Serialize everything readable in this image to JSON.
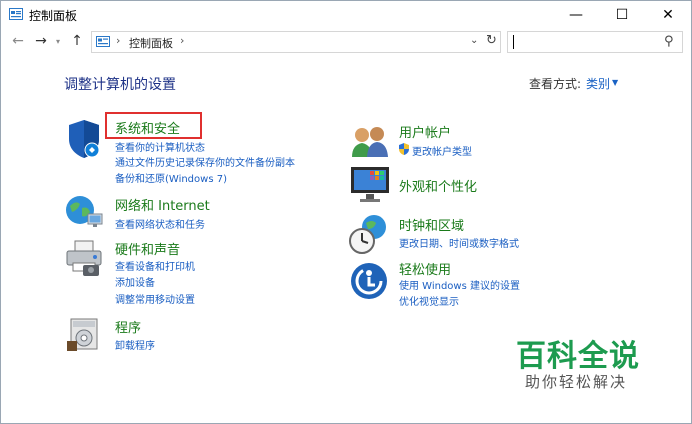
{
  "window": {
    "title": "控制面板",
    "controls": {
      "minimize": "—",
      "maximize": "☐",
      "close": "✕"
    }
  },
  "nav": {
    "back": "←",
    "forward": "→",
    "history": "▾",
    "up": "↑"
  },
  "address": {
    "separator": "›",
    "path": "控制面板",
    "dropdown": "⌄",
    "refresh": "↻"
  },
  "search": {
    "placeholder": "",
    "icon": "⚲"
  },
  "header": {
    "title": "调整计算机的设置",
    "view_by_label": "查看方式:",
    "view_by_value": "类别"
  },
  "categories": [
    {
      "title": "系统和安全",
      "icon": "shield-icon",
      "links": [
        "查看你的计算机状态",
        "通过文件历史记录保存你的文件备份副本",
        "备份和还原(Windows 7)"
      ]
    },
    {
      "title": "网络和 Internet",
      "icon": "network-globe-icon",
      "links": [
        "查看网络状态和任务"
      ]
    },
    {
      "title": "硬件和声音",
      "icon": "printer-icon",
      "links": [
        "查看设备和打印机",
        "添加设备",
        "调整常用移动设置"
      ]
    },
    {
      "title": "程序",
      "icon": "programs-icon",
      "links": [
        "卸载程序"
      ]
    },
    {
      "title": "用户帐户",
      "icon": "users-icon",
      "links": [
        "更改帐户类型"
      ]
    },
    {
      "title": "外观和个性化",
      "icon": "monitor-icon",
      "links": []
    },
    {
      "title": "时钟和区域",
      "icon": "clock-globe-icon",
      "links": [
        "更改日期、时间或数字格式"
      ]
    },
    {
      "title": "轻松使用",
      "icon": "ease-of-access-icon",
      "links": [
        "使用 Windows 建议的设置",
        "优化视觉显示"
      ]
    }
  ],
  "watermark": {
    "brand": "百科全说",
    "slogan": "助你轻松解决"
  },
  "colors": {
    "title_text": "#1e3287",
    "category_title": "#1a7a1a",
    "link": "#1a5ec2",
    "highlight": "#e0302f",
    "watermark": "#1d9b4f"
  }
}
